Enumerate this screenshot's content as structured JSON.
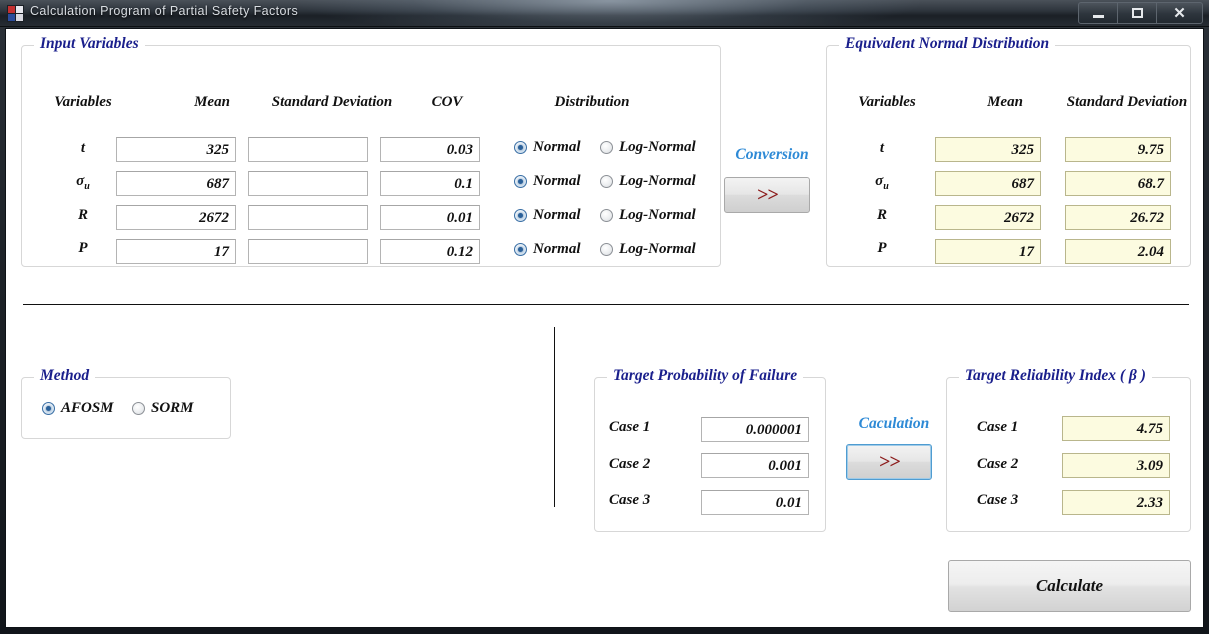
{
  "window": {
    "title": "Calculation Program of Partial Safety Factors",
    "icon": "app-icon",
    "minimize_label": "—",
    "maximize_label": "□",
    "close_label": "✕"
  },
  "input_variables": {
    "legend": "Input Variables",
    "headers": {
      "variables": "Variables",
      "mean": "Mean",
      "std": "Standard Deviation",
      "cov": "COV",
      "distribution": "Distribution"
    },
    "rows": [
      {
        "name": "t",
        "sub": "",
        "mean": "325",
        "std": "",
        "cov": "0.03",
        "normal_label": "Normal",
        "lognormal_label": "Log-Normal",
        "selected": "normal"
      },
      {
        "name": "σ",
        "sub": "u",
        "mean": "687",
        "std": "",
        "cov": "0.1",
        "normal_label": "Normal",
        "lognormal_label": "Log-Normal",
        "selected": "normal"
      },
      {
        "name": "R",
        "sub": "",
        "mean": "2672",
        "std": "",
        "cov": "0.01",
        "normal_label": "Normal",
        "lognormal_label": "Log-Normal",
        "selected": "normal"
      },
      {
        "name": "P",
        "sub": "",
        "mean": "17",
        "std": "",
        "cov": "0.12",
        "normal_label": "Normal",
        "lognormal_label": "Log-Normal",
        "selected": "normal"
      }
    ]
  },
  "conversion": {
    "label": "Conversion",
    "button_label": ">>"
  },
  "equivalent_normal": {
    "legend": "Equivalent Normal Distribution",
    "headers": {
      "variables": "Variables",
      "mean": "Mean",
      "std": "Standard Deviation"
    },
    "rows": [
      {
        "name": "t",
        "sub": "",
        "mean": "325",
        "std": "9.75"
      },
      {
        "name": "σ",
        "sub": "u",
        "mean": "687",
        "std": "68.7"
      },
      {
        "name": "R",
        "sub": "",
        "mean": "2672",
        "std": "26.72"
      },
      {
        "name": "P",
        "sub": "",
        "mean": "17",
        "std": "2.04"
      }
    ]
  },
  "method": {
    "legend": "Method",
    "options": [
      {
        "label": "AFOSM",
        "selected": true
      },
      {
        "label": "SORM",
        "selected": false
      }
    ]
  },
  "target_pf": {
    "legend": "Target Probability of Failure",
    "rows": [
      {
        "label": "Case 1",
        "value": "0.000001"
      },
      {
        "label": "Case 2",
        "value": "0.001"
      },
      {
        "label": "Case 3",
        "value": "0.01"
      }
    ]
  },
  "caculation": {
    "label": "Caculation",
    "button_label": ">>"
  },
  "target_beta": {
    "legend": "Target Reliability Index ( β )",
    "rows": [
      {
        "label": "Case 1",
        "value": "4.75"
      },
      {
        "label": "Case 2",
        "value": "3.09"
      },
      {
        "label": "Case 3",
        "value": "2.33"
      }
    ]
  },
  "calculate": {
    "label": "Calculate"
  },
  "colors": {
    "legend_blue": "#1a1f8c",
    "accent_blue": "#2e8ad6",
    "arrow_red": "#8b1a1a",
    "readonly_bg": "#fcfbe0"
  }
}
